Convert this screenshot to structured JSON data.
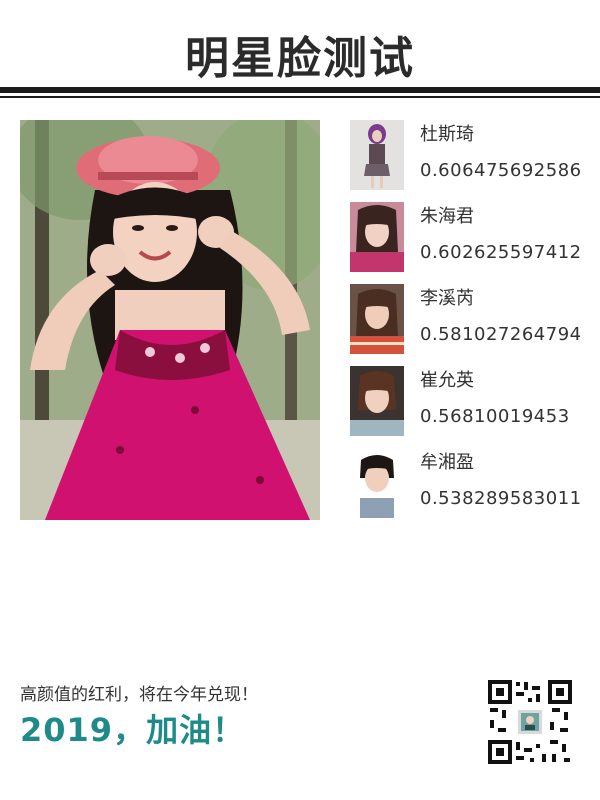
{
  "header": {
    "title": "明星脸测试"
  },
  "matches": [
    {
      "name": "杜斯琦",
      "score": "0.606475692586"
    },
    {
      "name": "朱海君",
      "score": "0.602625597412"
    },
    {
      "name": "李溪芮",
      "score": "0.581027264794"
    },
    {
      "name": "崔允英",
      "score": "0.56810019453"
    },
    {
      "name": "牟湘盈",
      "score": "0.538289583011"
    }
  ],
  "footer": {
    "caption": "高颜值的红利，将在今年兑现！",
    "slogan": "2019，加油！"
  },
  "colors": {
    "accent": "#1f8a8a",
    "rule": "#1c1c1c",
    "dress": "#d0116f"
  }
}
